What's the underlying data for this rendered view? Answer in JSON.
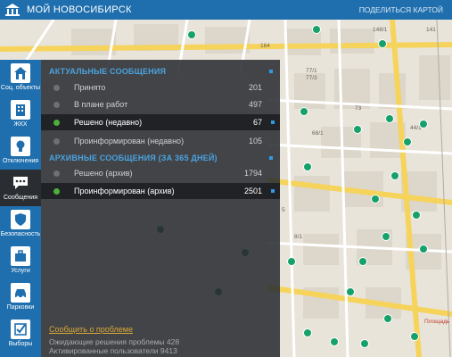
{
  "header": {
    "title": "МОЙ НОВОСИБИРСК",
    "share": "ПОДЕЛИТЬСЯ КАРТОЙ"
  },
  "sidebar": {
    "items": [
      {
        "label": "Соц. объекты",
        "icon": "home-icon"
      },
      {
        "label": "ЖКХ",
        "icon": "building-icon"
      },
      {
        "label": "Отключения",
        "icon": "lightbulb-icon"
      },
      {
        "label": "Сообщения",
        "icon": "chat-icon",
        "active": true
      },
      {
        "label": "Безопасность",
        "icon": "shield-icon"
      },
      {
        "label": "Услуги",
        "icon": "briefcase-icon"
      },
      {
        "label": "Парковки",
        "icon": "car-icon"
      },
      {
        "label": "Выборы",
        "icon": "checkbox-icon"
      }
    ]
  },
  "panel": {
    "current_title": "АКТУАЛЬНЫЕ СООБЩЕНИЯ",
    "current_items": [
      {
        "label": "Принято",
        "count": "201"
      },
      {
        "label": "В плане работ",
        "count": "497"
      },
      {
        "label": "Решено (недавно)",
        "count": "67"
      },
      {
        "label": "Проинформирован (недавно)",
        "count": "105"
      }
    ],
    "archive_title": "АРХИВНЫЕ СООБЩЕНИЯ (ЗА 365 ДНЕЙ)",
    "archive_items": [
      {
        "label": "Решено (архив)",
        "count": "1794"
      },
      {
        "label": "Проинформирован (архив)",
        "count": "2501"
      }
    ],
    "report_link": "Сообщить о проблеме",
    "stats": [
      "Ожидающие решения проблемы 428",
      "Активированные пользователи 9413"
    ]
  },
  "map": {
    "labels": [
      "164",
      "148/1",
      "141",
      "77/1",
      "77/3",
      "73",
      "68/1",
      "44/1",
      "5",
      "8/1",
      "Площадь"
    ]
  },
  "colors": {
    "topbar": "#1f6fae",
    "panel": "#2a2d32",
    "accent": "#4aa3e0",
    "green": "#4caf3c",
    "link": "#d9a73a"
  }
}
